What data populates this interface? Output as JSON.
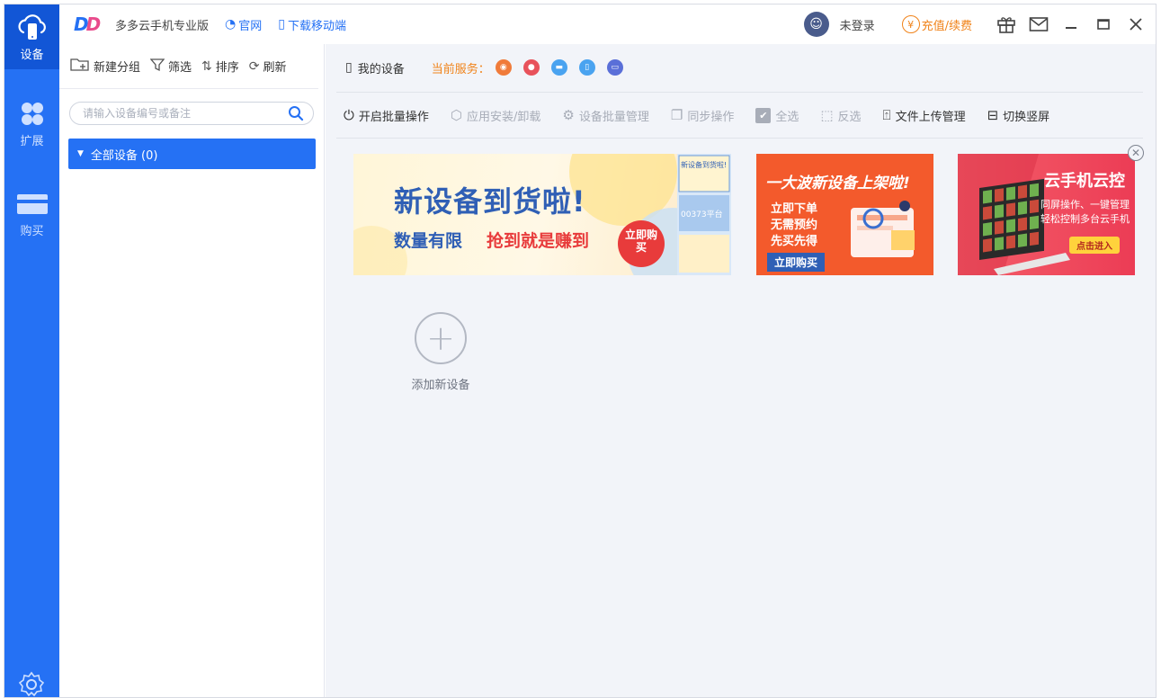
{
  "app": {
    "title": "多多云手机专业版",
    "logo_text": "DD"
  },
  "titlebar": {
    "official_site": "官网",
    "download_mobile": "下载移动端",
    "login_status": "未登录",
    "recharge": "充值/续费"
  },
  "rail": {
    "items": [
      {
        "label": "设备",
        "icon": "cloud-phone-icon",
        "active": true
      },
      {
        "label": "扩展",
        "icon": "grid-icon",
        "active": false
      },
      {
        "label": "购买",
        "icon": "card-icon",
        "active": false
      }
    ],
    "settings_icon": "gear-icon"
  },
  "left_panel": {
    "toolbar": {
      "new_group": "新建分组",
      "filter": "筛选",
      "sort": "排序",
      "refresh": "刷新"
    },
    "search_placeholder": "请输入设备编号或备注",
    "group_label": "全部设备 (0)"
  },
  "main": {
    "my_devices": "我的设备",
    "current_service": "当前服务：",
    "service_colors": [
      "#f07b3a",
      "#e8525b",
      "#4aa3f0",
      "#4aa3f0",
      "#5a6fd8"
    ],
    "ops": [
      {
        "label": "开启批量操作",
        "enabled": true,
        "icon": "power-icon"
      },
      {
        "label": "应用安装/卸载",
        "enabled": false,
        "icon": "package-icon"
      },
      {
        "label": "设备批量管理",
        "enabled": false,
        "icon": "settings-icon"
      },
      {
        "label": "同步操作",
        "enabled": false,
        "icon": "copy-icon"
      },
      {
        "label": "全选",
        "enabled": false,
        "icon": "checkbox-icon"
      },
      {
        "label": "反选",
        "enabled": false,
        "icon": "cursor-icon"
      },
      {
        "label": "文件上传管理",
        "enabled": true,
        "icon": "upload-icon"
      },
      {
        "label": "切换竖屏",
        "enabled": true,
        "icon": "rotate-icon"
      }
    ],
    "banners": [
      {
        "headline": "新设备到货啦!",
        "subline": "数量有限",
        "subline2": "抢到就是赚到",
        "badge": "立即购买",
        "thumb1": "新设备到货啦!",
        "thumb2": "00373平台"
      },
      {
        "headline": "一大波新设备上架啦!",
        "line1": "立即下单",
        "line2": "无需预约",
        "line3": "先买先得",
        "cta": "立即购买"
      },
      {
        "headline": "云手机云控",
        "line1": "同屏操作、一键管理",
        "line2": "轻松控制多台云手机",
        "cta": "点击进入"
      }
    ],
    "add_device": "添加新设备"
  }
}
